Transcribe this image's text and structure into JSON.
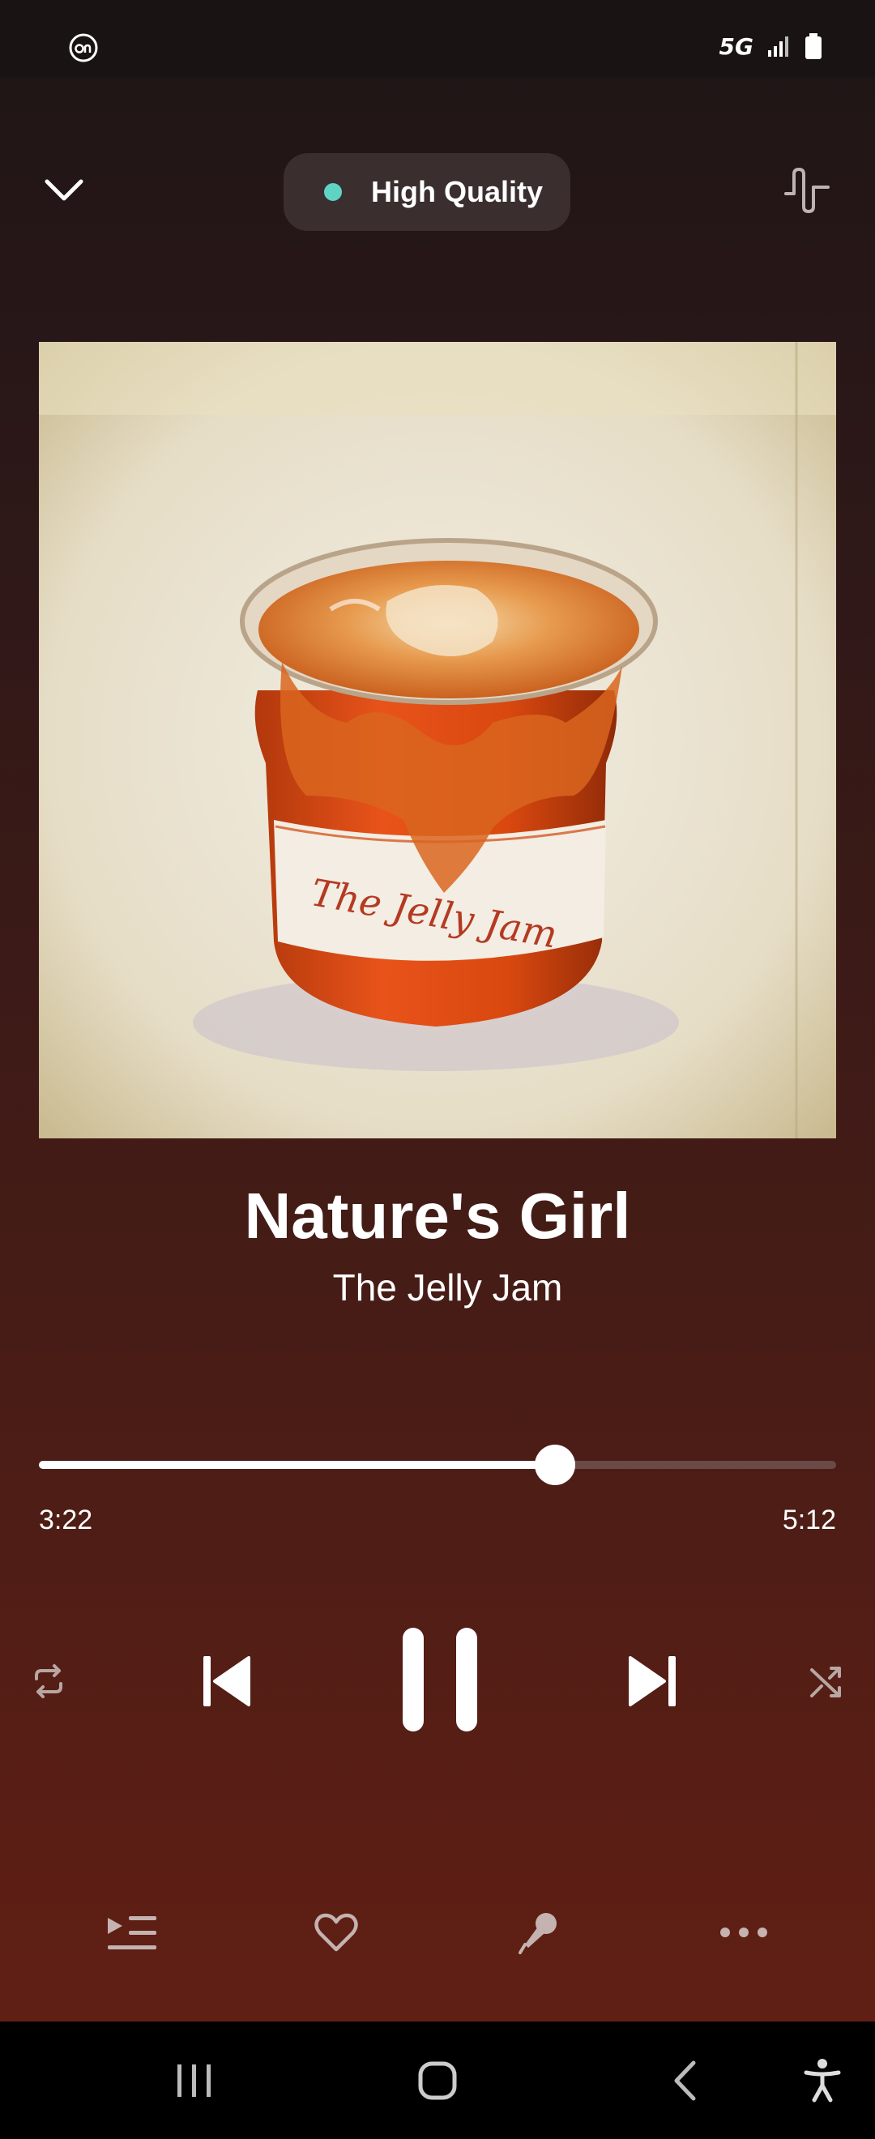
{
  "status_bar": {
    "network": "5G"
  },
  "header": {
    "quality_label": "High Quality"
  },
  "track": {
    "title": "Nature's Girl",
    "artist": "The Jelly Jam",
    "elapsed": "3:22",
    "duration": "5:12",
    "progress_fraction": 0.647
  },
  "artwork": {
    "label_text": "The Jelly Jam"
  },
  "colors": {
    "quality_dot": "#5fd3c4",
    "background_top": "#1e1516",
    "background_bottom": "#611f14"
  },
  "icons": {
    "collapse": "chevron-down-icon",
    "equalizer": "waveform-icon",
    "repeat": "repeat-icon",
    "previous": "skip-previous-icon",
    "pause": "pause-icon",
    "next": "skip-next-icon",
    "shuffle": "shuffle-icon",
    "queue": "queue-icon",
    "like": "heart-icon",
    "lyrics": "microphone-icon",
    "more": "more-dots-icon"
  }
}
